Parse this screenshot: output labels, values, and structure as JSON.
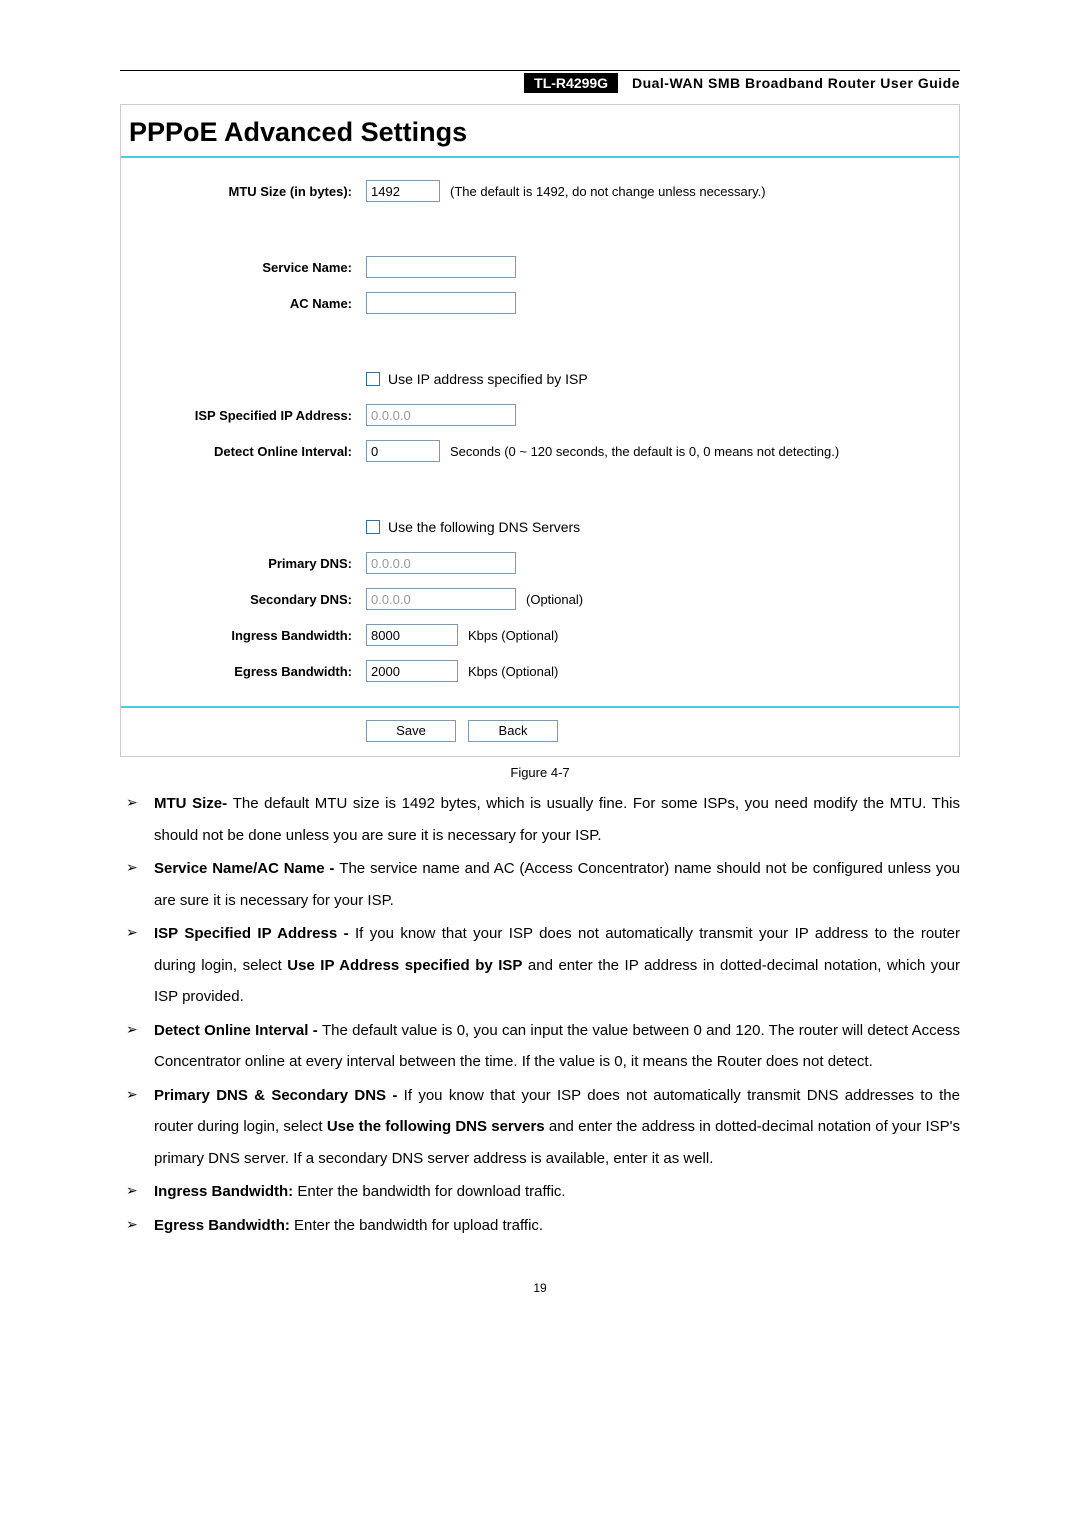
{
  "header": {
    "model": "TL-R4299G",
    "title": "Dual-WAN SMB Broadband Router User Guide"
  },
  "panel": {
    "heading": "PPPoE Advanced Settings",
    "mtu_label": "MTU Size (in bytes):",
    "mtu_value": "1492",
    "mtu_hint": "(The default is 1492, do not change unless necessary.)",
    "service_name_label": "Service Name:",
    "service_name_value": "",
    "ac_name_label": "AC Name:",
    "ac_name_value": "",
    "use_isp_ip_label": "Use IP address specified by ISP",
    "isp_ip_label": "ISP Specified IP Address:",
    "isp_ip_value": "0.0.0.0",
    "detect_label": "Detect Online Interval:",
    "detect_value": "0",
    "detect_hint": "Seconds (0 ~ 120 seconds, the default is 0, 0 means not detecting.)",
    "use_dns_label": "Use the following DNS Servers",
    "primary_dns_label": "Primary DNS:",
    "primary_dns_value": "0.0.0.0",
    "secondary_dns_label": "Secondary DNS:",
    "secondary_dns_value": "0.0.0.0",
    "secondary_dns_hint": "(Optional)",
    "ingress_label": "Ingress Bandwidth:",
    "ingress_value": "8000",
    "ingress_hint": "Kbps (Optional)",
    "egress_label": "Egress Bandwidth:",
    "egress_value": "2000",
    "egress_hint": "Kbps (Optional)",
    "save_btn": "Save",
    "back_btn": "Back"
  },
  "figure_caption": "Figure 4-7",
  "descriptions": {
    "mtu_bold": "MTU Size- ",
    "mtu_text": "The default MTU size is 1492 bytes, which is usually fine. For some ISPs, you need modify the MTU. This should not be done unless you are sure it is necessary for your ISP.",
    "svc_bold": "Service Name/AC Name - ",
    "svc_text": "The service name and AC (Access Concentrator) name should not be configured unless you are sure it is necessary for your ISP.",
    "isp_bold": "ISP Specified IP Address - ",
    "isp_text_a": "If you know that your ISP does not automatically transmit your IP address to the router during login, select ",
    "isp_text_bold2": "Use IP Address specified by ISP",
    "isp_text_b": " and enter the IP address in dotted-decimal notation, which your ISP provided.",
    "detect_bold": "Detect Online Interval - ",
    "detect_text": "The default value is 0, you can input the value between 0 and 120. The router will detect Access Concentrator online at every interval between the time. If the value is 0, it means the Router does not detect.",
    "dns_bold": "Primary DNS & Secondary DNS - ",
    "dns_text_a": "If you know that your ISP does not automatically transmit DNS addresses to the router during login, select ",
    "dns_text_bold2": "Use the following DNS servers",
    "dns_text_b": " and enter the address in dotted-decimal notation of your ISP's primary DNS server. If a secondary DNS server address is available, enter it as well.",
    "ingress_bold": "Ingress Bandwidth: ",
    "ingress_text": "Enter the bandwidth for download traffic.",
    "egress_bold": "Egress Bandwidth: ",
    "egress_text": "Enter the bandwidth for upload traffic."
  },
  "page_number": "19"
}
